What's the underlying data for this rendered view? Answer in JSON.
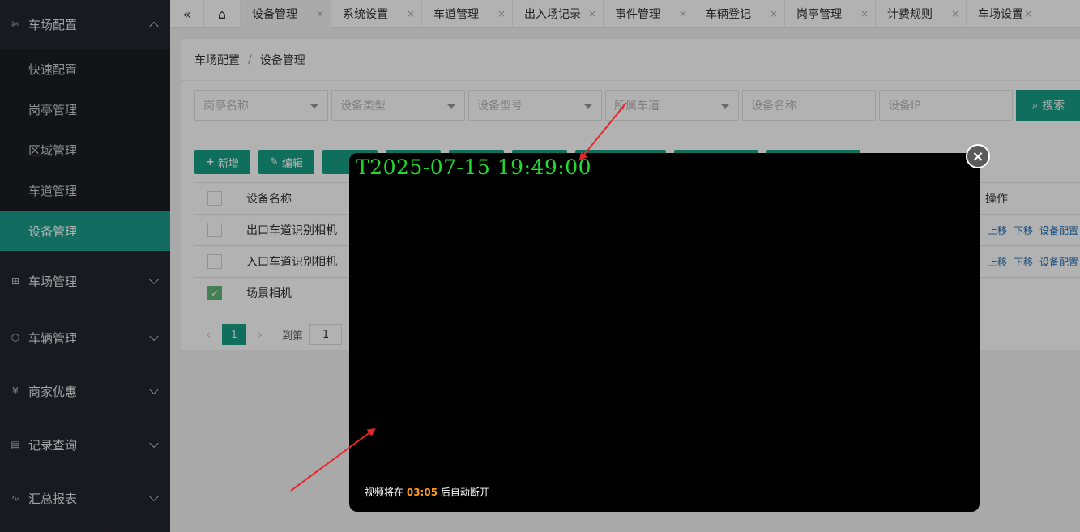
{
  "sidebar": {
    "group_active": "车场配置",
    "sub_items": [
      "快速配置",
      "岗亭管理",
      "区域管理",
      "车道管理",
      "设备管理"
    ],
    "groups": [
      "车场管理",
      "车辆管理",
      "商家优惠",
      "记录查询",
      "汇总报表"
    ]
  },
  "tabs": {
    "back_icon": "«",
    "home_icon": "⌂",
    "items": [
      "设备管理",
      "系统设置",
      "车道管理",
      "出入场记录",
      "事件管理",
      "车辆登记",
      "岗亭管理",
      "计费规则",
      "车场设置"
    ],
    "close_glyph": "×"
  },
  "breadcrumb": {
    "parent": "车场配置",
    "sep": "/",
    "current": "设备管理"
  },
  "filters": {
    "booth": "岗亭名称",
    "type": "设备类型",
    "model": "设备型号",
    "lane": "所属车道",
    "name": "设备名称",
    "ip": "设备IP",
    "search": "搜索"
  },
  "toolbar": {
    "add": "新增",
    "edit": "编辑"
  },
  "table": {
    "col_name": "设备名称",
    "col_ops": "操作",
    "rows": [
      {
        "name": "出口车道识别相机",
        "checked": false,
        "ops": [
          "上移",
          "下移",
          "设备配置"
        ]
      },
      {
        "name": "入口车道识别相机",
        "checked": false,
        "ops": [
          "上移",
          "下移",
          "设备配置"
        ]
      },
      {
        "name": "场景相机",
        "checked": true,
        "ops": []
      }
    ]
  },
  "pager": {
    "current": "1",
    "goto_label": "到第",
    "goto_value": "1"
  },
  "video": {
    "timestamp": "T2025-07-15 19:49:00",
    "note_prefix": "视频将在",
    "countdown": "03:05",
    "note_suffix": "后自动断开",
    "close_glyph": "×"
  },
  "colors": {
    "accent": "#16a085",
    "sidebar_bg": "#23262e",
    "timestamp_green": "#22d92f",
    "countdown_orange": "#ff9a1f",
    "arrow_red": "#e8262a"
  }
}
